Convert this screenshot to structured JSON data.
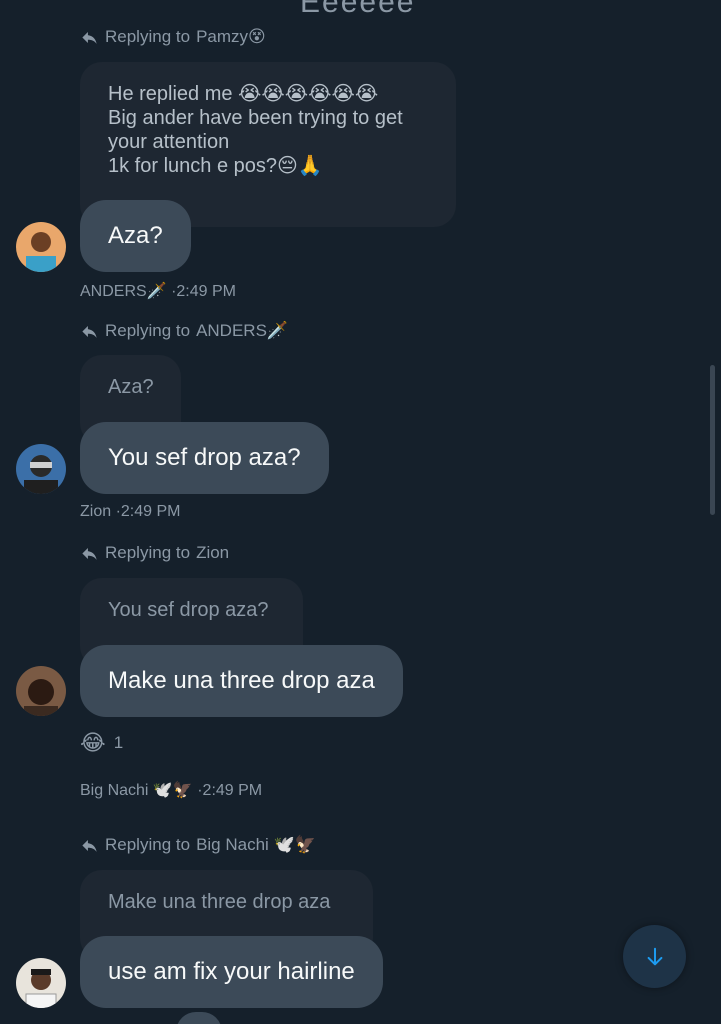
{
  "header_clip": "Eeeeee",
  "messages": [
    {
      "reply_label": "Replying to",
      "reply_to": "Pamzy😵",
      "quoted_lines": [
        "He replied  me 😭😭😭😭😭😭",
        "Big ander have been trying to get",
        "your attention",
        "1k for lunch e pos?😔🙏"
      ],
      "text": "Aza?",
      "author": "ANDERS🗡️",
      "time": "·2:49 PM"
    },
    {
      "reply_label": "Replying to",
      "reply_to": "ANDERS🗡️",
      "quoted_lines": [
        "Aza?"
      ],
      "text": "You sef drop aza?",
      "author": "Zion",
      "time": "·2:49 PM"
    },
    {
      "reply_label": "Replying to",
      "reply_to": "Zion",
      "quoted_lines": [
        "You sef drop aza?"
      ],
      "text": "Make una three drop aza",
      "reaction_emoji": "😂",
      "reaction_count": "1",
      "author": "Big Nachi 🕊️🦅",
      "time": "·2:49 PM"
    },
    {
      "reply_label": "Replying to",
      "reply_to": "Big Nachi 🕊️🦅",
      "quoted_lines": [
        "Make una three drop aza"
      ],
      "text": "use am fix your hairline"
    }
  ],
  "icons": {
    "reply": "reply-arrow-icon",
    "scroll_down": "arrow-down-icon"
  },
  "colors": {
    "background": "#15202b",
    "bubble": "#3c4a58",
    "quoted_bubble": "#1e2732",
    "muted_text": "#8b98a5",
    "accent": "#1d9bf0"
  }
}
